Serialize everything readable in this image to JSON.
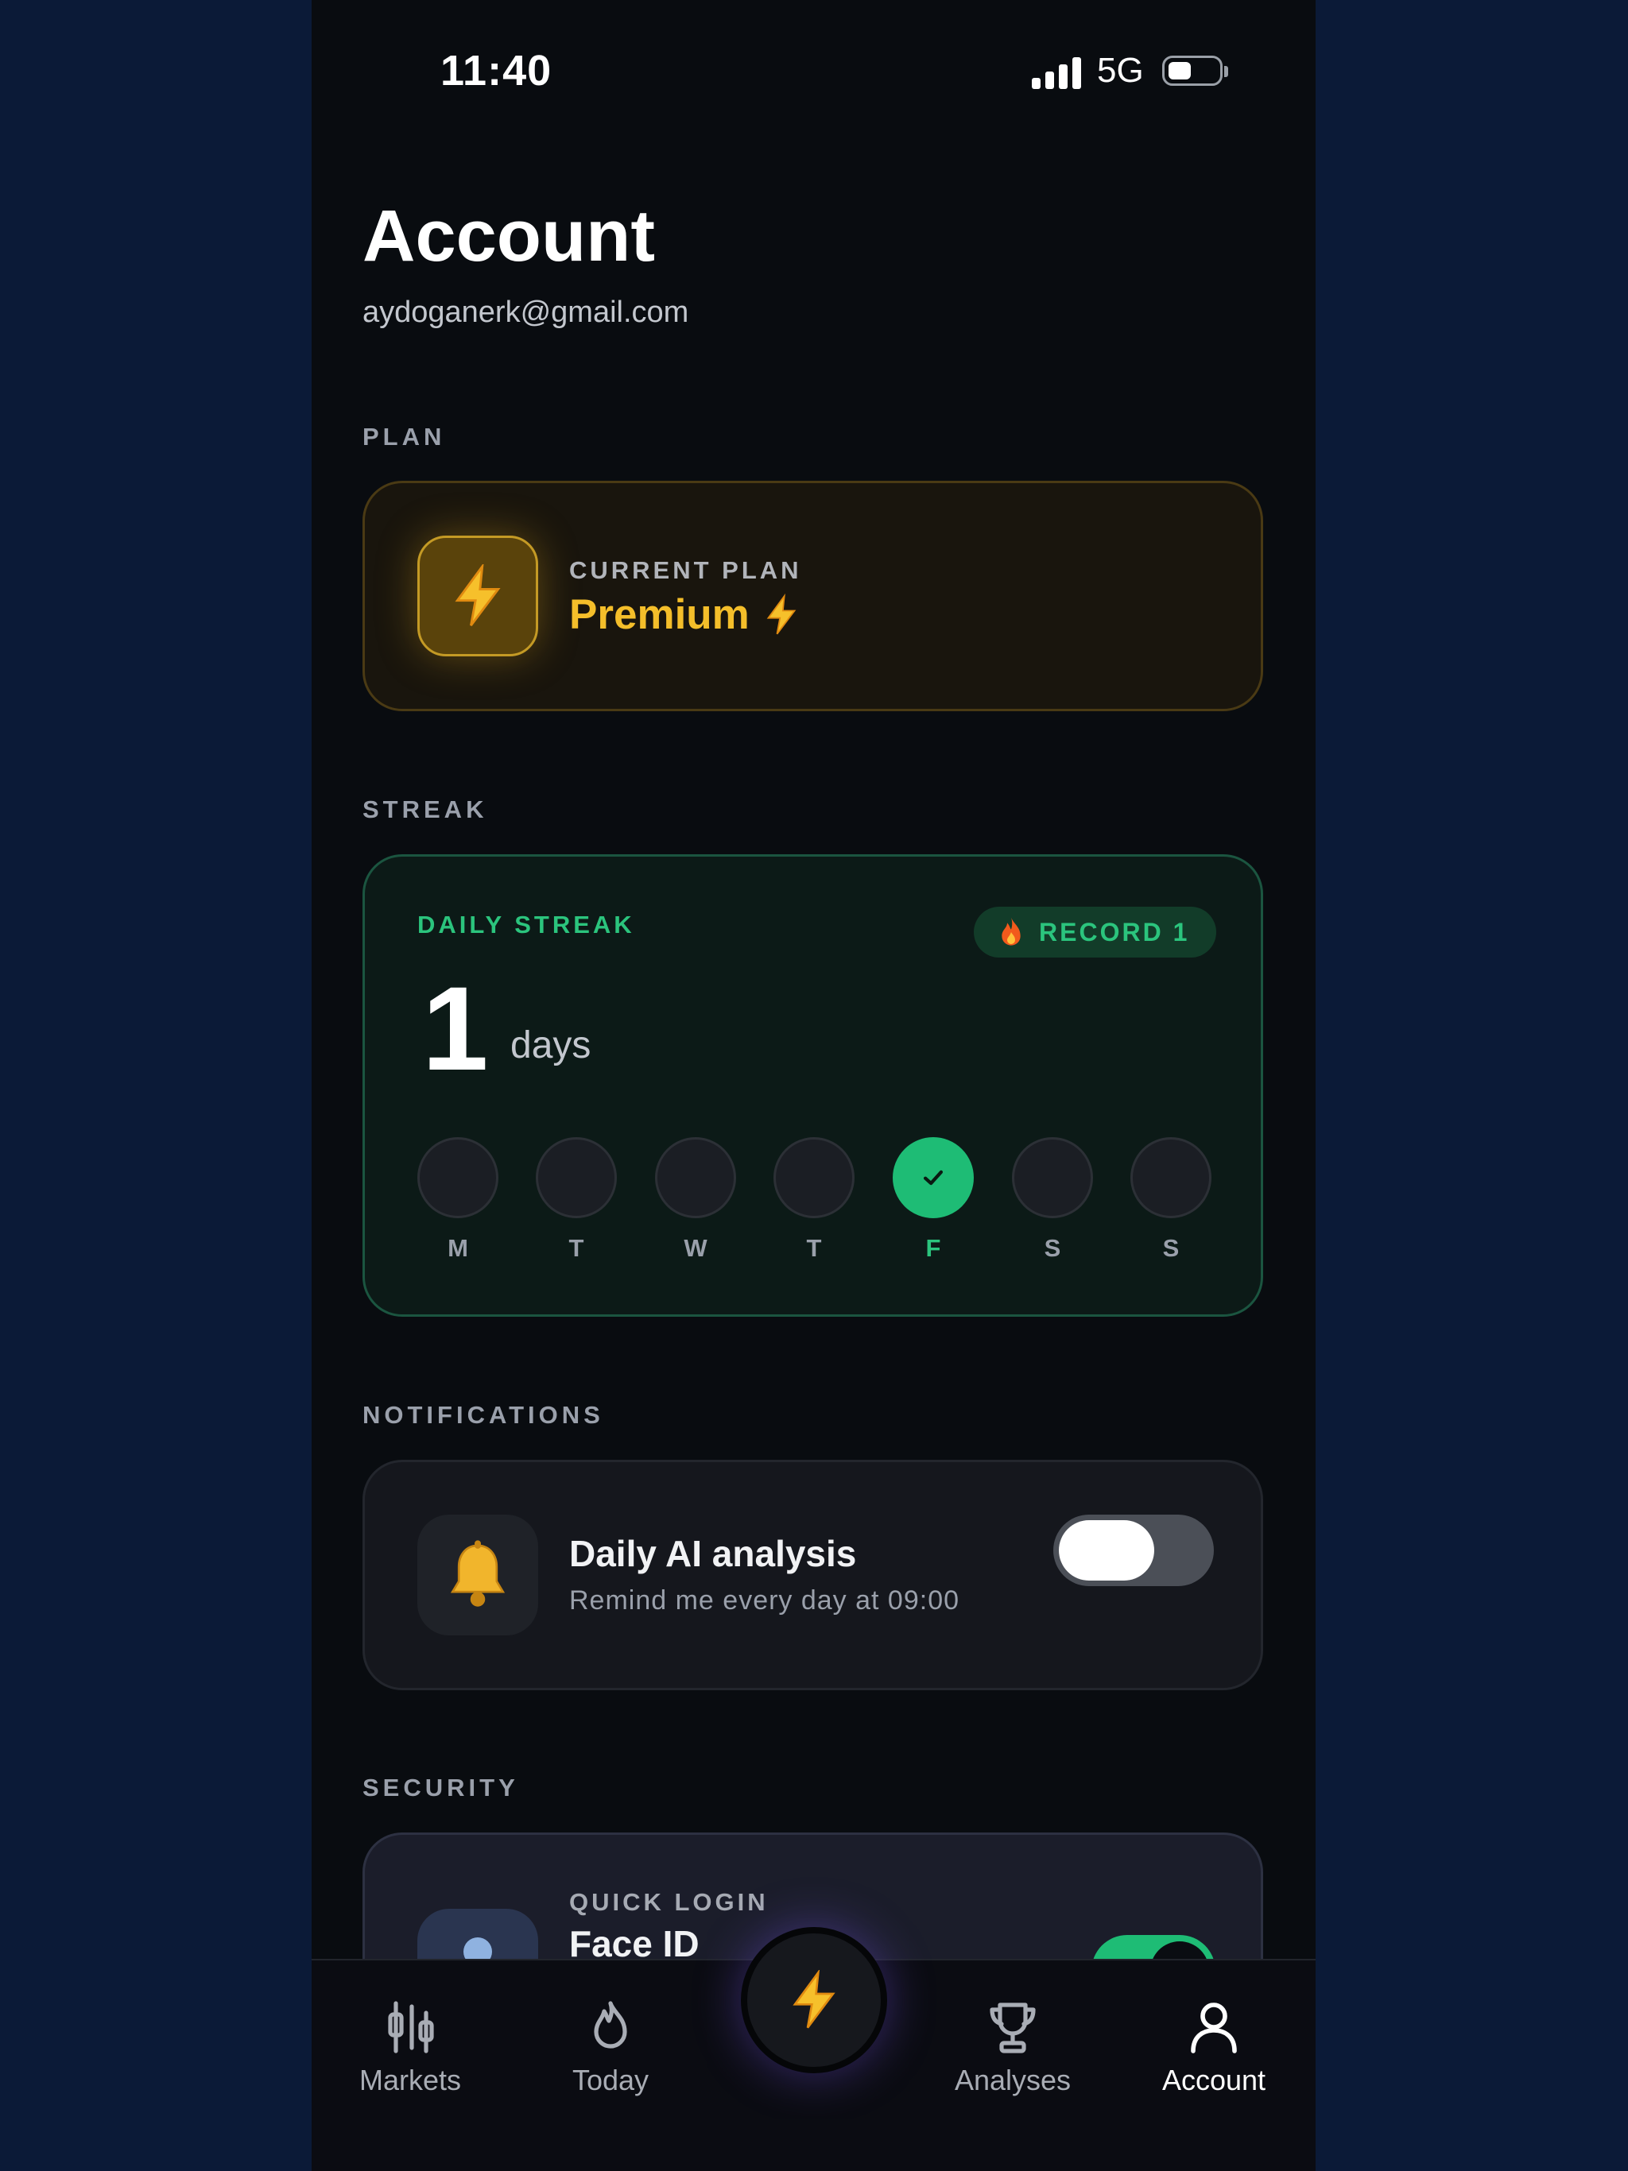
{
  "status_bar": {
    "time": "11:40",
    "network": "5G"
  },
  "header": {
    "title": "Account",
    "email": "aydoganerk@gmail.com"
  },
  "plan": {
    "section_label": "PLAN",
    "caption": "CURRENT PLAN",
    "name": "Premium",
    "icon": "lightning-bolt-icon",
    "accent_color": "#f4be2a"
  },
  "streak": {
    "section_label": "STREAK",
    "caption": "DAILY STREAK",
    "record_label": "RECORD 1",
    "count": "1",
    "unit": "days",
    "accent_color": "#1ebc75",
    "days": [
      {
        "label": "M",
        "done": false
      },
      {
        "label": "T",
        "done": false
      },
      {
        "label": "W",
        "done": false
      },
      {
        "label": "T",
        "done": false
      },
      {
        "label": "F",
        "done": true
      },
      {
        "label": "S",
        "done": false
      },
      {
        "label": "S",
        "done": false
      }
    ]
  },
  "notifications": {
    "section_label": "NOTIFICATIONS",
    "title": "Daily AI analysis",
    "subtitle": "Remind me every day at 09:00",
    "icon": "bell-icon",
    "enabled": false
  },
  "security": {
    "section_label": "SECURITY",
    "caption": "QUICK LOGIN",
    "title": "Face ID",
    "enabled": true
  },
  "tabbar": {
    "items": [
      {
        "label": "Markets",
        "icon": "candlestick-chart-icon"
      },
      {
        "label": "Today",
        "icon": "flame-icon"
      },
      {
        "label": "Analyses",
        "icon": "trophy-icon"
      },
      {
        "label": "Account",
        "icon": "user-icon",
        "active": true
      }
    ],
    "center_icon": "lightning-bolt-icon"
  }
}
